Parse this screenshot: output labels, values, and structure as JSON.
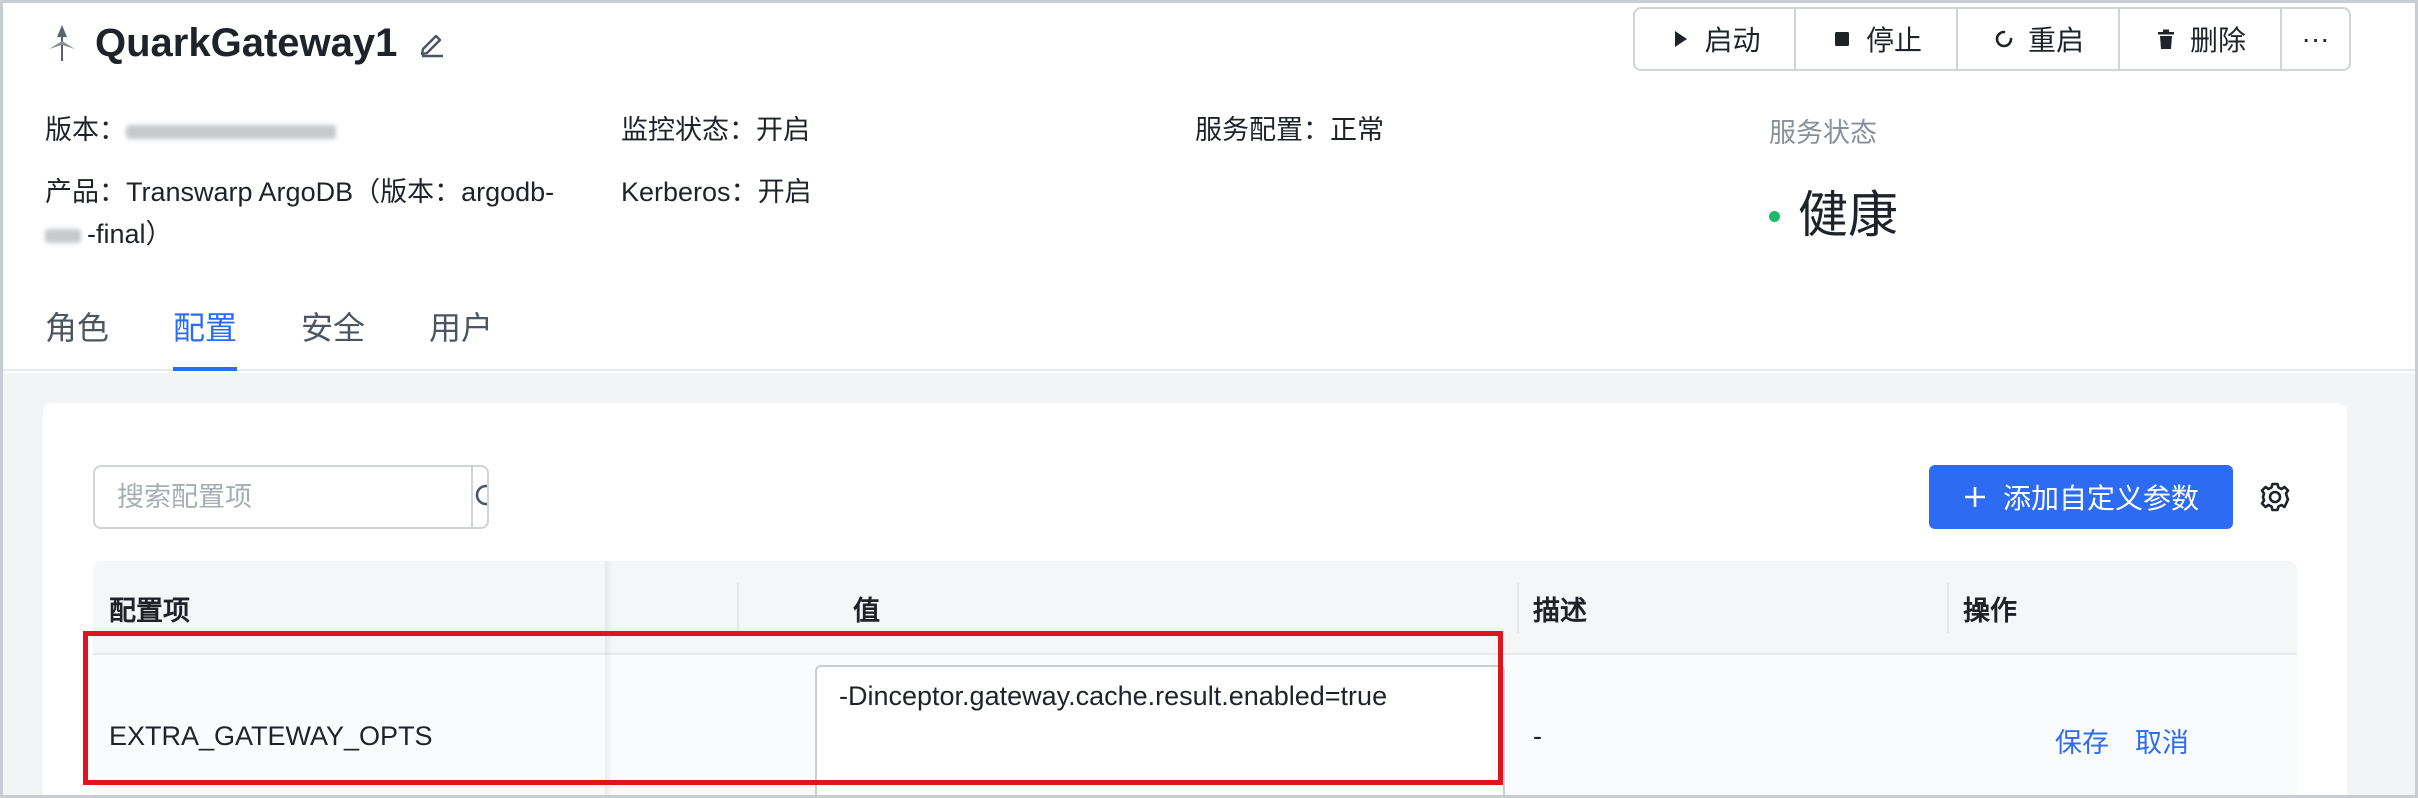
{
  "header": {
    "title": "QuarkGateway1",
    "actions": {
      "start": "启动",
      "stop": "停止",
      "restart": "重启",
      "delete": "删除",
      "more": "···"
    },
    "version_label": "版本：",
    "monitor_label": "监控状态：",
    "monitor_value": "开启",
    "service_config_label": "服务配置：",
    "service_config_value": "正常",
    "product_label": "产品：",
    "product_value_line1": "Transwarp ArgoDB（版本：argodb-",
    "product_value_line2": "-final）",
    "kerberos_label": "Kerberos：",
    "kerberos_value": "开启",
    "service_status_label": "服务状态",
    "service_status_value": "健康",
    "status_color": "#1eb86b"
  },
  "tabs": [
    {
      "label": "角色",
      "active": false
    },
    {
      "label": "配置",
      "active": true
    },
    {
      "label": "安全",
      "active": false
    },
    {
      "label": "用户",
      "active": false
    }
  ],
  "toolbar": {
    "search_placeholder": "搜索配置项",
    "add_label": "添加自定义参数"
  },
  "table": {
    "columns": [
      "配置项",
      "值",
      "描述",
      "操作"
    ],
    "rows": [
      {
        "name": "EXTRA_GATEWAY_OPTS",
        "value": "-Dinceptor.gateway.cache.result.enabled=true",
        "description": "-",
        "save": "保存",
        "cancel": "取消"
      }
    ]
  },
  "colors": {
    "accent": "#2c6bf2",
    "highlight": "#e0141c"
  }
}
